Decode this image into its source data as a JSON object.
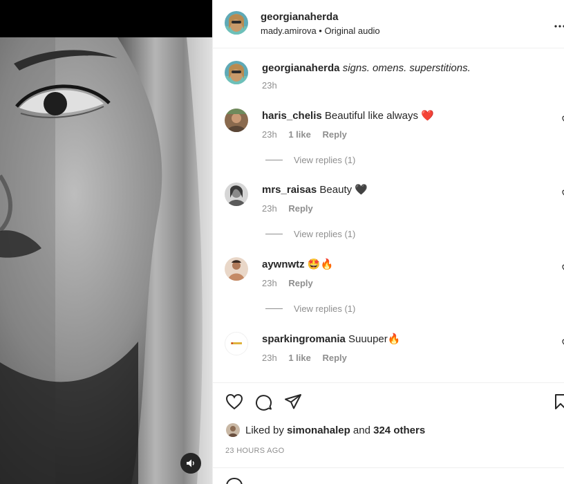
{
  "header": {
    "username": "georgianaherda",
    "subtitle": "mady.amirova • Original audio",
    "more_icon": "more-horizontal-icon"
  },
  "caption": {
    "username": "georgianaherda",
    "text": "signs. omens. superstitions.",
    "time": "23h"
  },
  "comments": [
    {
      "username": "haris_chelis",
      "text": "Beautiful like always",
      "emoji": "❤️",
      "time": "23h",
      "likes": "1 like",
      "reply": "Reply",
      "view_replies": "View replies (1)"
    },
    {
      "username": "mrs_raisas",
      "text": "Beauty",
      "emoji": "🖤",
      "time": "23h",
      "reply": "Reply",
      "view_replies": "View replies (1)"
    },
    {
      "username": "aywnwtz",
      "text": "",
      "emoji": "🤩🔥",
      "time": "23h",
      "reply": "Reply",
      "view_replies": "View replies (1)"
    },
    {
      "username": "sparkingromania",
      "text": "Suuuper",
      "emoji": "🔥",
      "time": "23h",
      "likes": "1 like",
      "reply": "Reply"
    }
  ],
  "footer": {
    "liked_prefix": "Liked by",
    "liked_user": "simonahalep",
    "liked_and": "and",
    "liked_others": "324 others",
    "time_ago": "23 HOURS AGO"
  },
  "media": {
    "sound_icon": "speaker-icon"
  },
  "colors": {
    "muted": "#8e8e8e",
    "text": "#262626",
    "heart": "#ed4956"
  }
}
